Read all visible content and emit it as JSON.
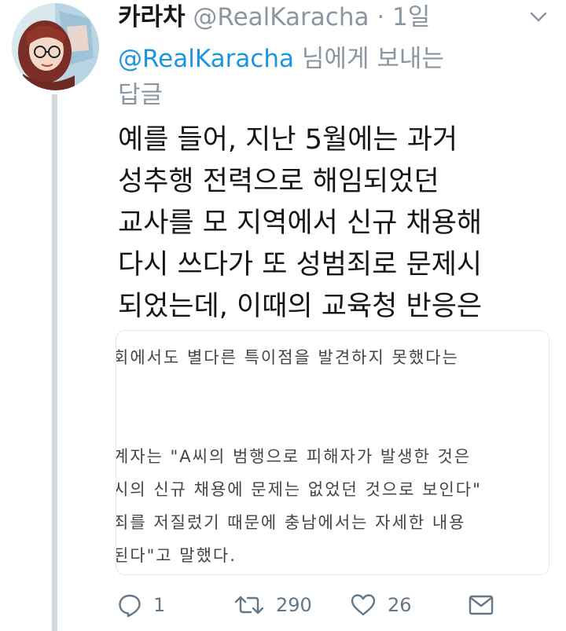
{
  "tweet": {
    "display_name": "카라차",
    "handle": "@RealKaracha",
    "separator": "·",
    "time": "1일",
    "reply_to": {
      "mention": "@RealKaracha",
      "suffix": " 님에게 보내는",
      "line2": "답글"
    },
    "text_lines": [
      "예를 들어, 지난 5월에는 과거",
      "성추행 전력으로 해임되었던",
      "교사를 모 지역에서 신규 채용해",
      "다시 쓰다가 또 성범죄로 문제시",
      "되었는데, 이때의 교육청 반응은"
    ],
    "image_text_lines": [
      "회에서도 별다른 특이점을 발견하지 못했다는 ",
      "계자는 \"A씨의 범행으로 피해자가 발생한 것은",
      "시의 신규 채용에 문제는 없었던 것으로 보인다\"",
      "죄를 저질렀기 때문에 충남에서는 자세한 내용",
      "된다\"고 말했다."
    ],
    "actions": {
      "reply_count": "1",
      "retweet_count": "290",
      "like_count": "26"
    }
  },
  "colors": {
    "accent": "#1b95e0",
    "secondary_text": "#8a97a3",
    "primary_text": "#14171a",
    "thread_line": "#cfd9de"
  },
  "icons": [
    "chevron-down-icon",
    "reply-icon",
    "retweet-icon",
    "like-icon",
    "direct-message-icon"
  ]
}
